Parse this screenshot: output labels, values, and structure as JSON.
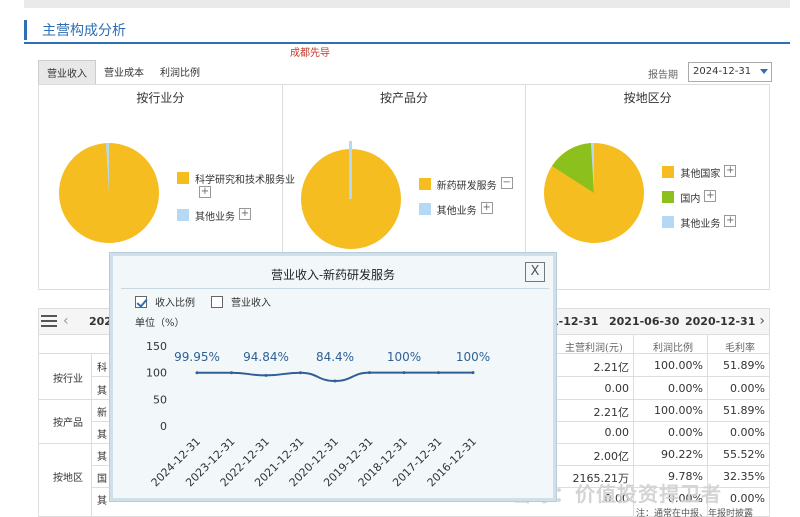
{
  "header": {
    "title": "主营构成分析"
  },
  "company": "成都先导",
  "tabs": [
    "营业收入",
    "营业成本",
    "利润比例"
  ],
  "period": {
    "label": "报告期",
    "value": "2024-12-31"
  },
  "panels": [
    {
      "title": "按行业分",
      "legend": [
        {
          "label": "科学研究和技术服务业",
          "color": "#f5bd1f"
        },
        {
          "label": "其他业务",
          "color": "#b5d9f5"
        }
      ]
    },
    {
      "title": "按产品分",
      "legend": [
        {
          "label": "新药研发服务",
          "color": "#f5bd1f"
        },
        {
          "label": "其他业务",
          "color": "#b5d9f5"
        }
      ]
    },
    {
      "title": "按地区分",
      "legend": [
        {
          "label": "其他国家",
          "color": "#f5bd1f"
        },
        {
          "label": "国内",
          "color": "#8cc11d"
        },
        {
          "label": "其他业务",
          "color": "#b5d9f5"
        }
      ]
    }
  ],
  "table": {
    "date_tabs": [
      "2021-12-31",
      "2021-06-30",
      "2020-12-31"
    ],
    "partial_first_tab": "202",
    "partial_second_tab": "1-12-31",
    "columns": [
      "主营利润(元)",
      "利润比例",
      "毛利率"
    ],
    "groups": [
      {
        "label": "按行业",
        "rows": [
          "科",
          "其"
        ]
      },
      {
        "label": "按产品",
        "rows": [
          "新",
          "其"
        ]
      },
      {
        "label": "按地区",
        "rows": [
          "其",
          "国",
          "其"
        ]
      }
    ],
    "rows": [
      [
        "2.21亿",
        "100.00%",
        "51.89%"
      ],
      [
        "0.00",
        "0.00%",
        "0.00%"
      ],
      [
        "2.21亿",
        "100.00%",
        "51.89%"
      ],
      [
        "0.00",
        "0.00%",
        "0.00%"
      ],
      [
        "2.00亿",
        "90.22%",
        "55.52%"
      ],
      [
        "2165.21万",
        "9.78%",
        "32.35%"
      ],
      [
        "0.00",
        "0.00%",
        "0.00%"
      ]
    ]
  },
  "note": "注：通常在中报、年报时披露",
  "watermark": "雪球：价值投资捍卫者",
  "popup": {
    "title": "营业收入-新药研发服务",
    "close": "X",
    "checkbox_ratio": "收入比例",
    "checkbox_revenue": "营业收入",
    "unit": "单位（%）"
  },
  "chart_data": {
    "type": "line",
    "x": [
      "2024-12-31",
      "2023-12-31",
      "2022-12-31",
      "2021-12-31",
      "2020-12-31",
      "2019-12-31",
      "2018-12-31",
      "2017-12-31",
      "2016-12-31"
    ],
    "values": [
      99.95,
      99.95,
      94.84,
      99.95,
      84.4,
      100,
      100,
      100,
      100
    ],
    "labels": [
      "99.95%",
      "",
      "94.84%",
      "",
      "84.4%",
      "",
      "100%",
      "",
      "100%"
    ],
    "ylim": [
      0,
      150
    ],
    "yticks": [
      0,
      50,
      100,
      150
    ],
    "color": "#2f5f96"
  }
}
